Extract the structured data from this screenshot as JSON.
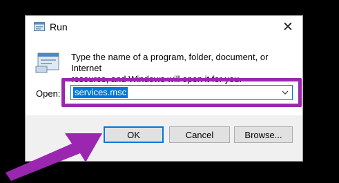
{
  "window": {
    "title": "Run",
    "close_glyph": "✕",
    "icon": "run-app-icon"
  },
  "description": {
    "line1": "Type the name of a program, folder, document, or Internet",
    "line2": "resource, and Windows will open it for you."
  },
  "open": {
    "label": "Open:",
    "value": "services.msc"
  },
  "buttons": {
    "ok": "OK",
    "cancel": "Cancel",
    "browse": "Browse..."
  },
  "colors": {
    "accent": "#0078d7",
    "highlight": "#9b27b0"
  }
}
